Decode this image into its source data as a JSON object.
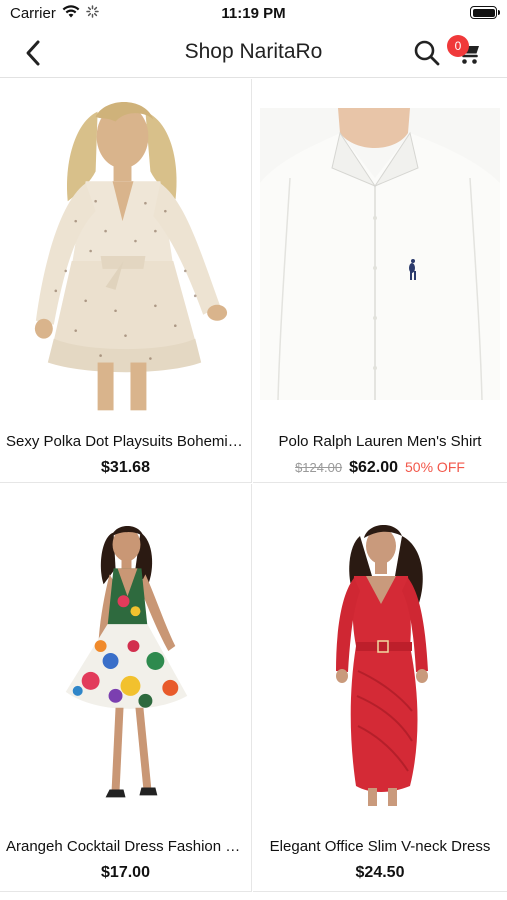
{
  "status_bar": {
    "carrier": "Carrier",
    "time": "11:19 PM"
  },
  "nav": {
    "title": "Shop NaritaRo",
    "cart_count": "0"
  },
  "icons": {
    "back": "chevron-left-icon",
    "search": "search-icon",
    "cart": "cart-icon"
  },
  "colors": {
    "badge": "#f0393a",
    "discount": "#f2574a",
    "strikethrough": "#9a9a9a"
  },
  "products": [
    {
      "name": "Sexy Polka Dot Playsuits Bohemia...",
      "price": "$31.68",
      "original_price": "",
      "discount": ""
    },
    {
      "name": "Polo Ralph Lauren Men's Shirt",
      "price": "$62.00",
      "original_price": "$124.00",
      "discount": "50% OFF"
    },
    {
      "name": "Arangeh Cocktail Dress Fashion 2...",
      "price": "$17.00",
      "original_price": "",
      "discount": ""
    },
    {
      "name": "Elegant Office Slim V-neck Dress",
      "price": "$24.50",
      "original_price": "",
      "discount": ""
    }
  ]
}
